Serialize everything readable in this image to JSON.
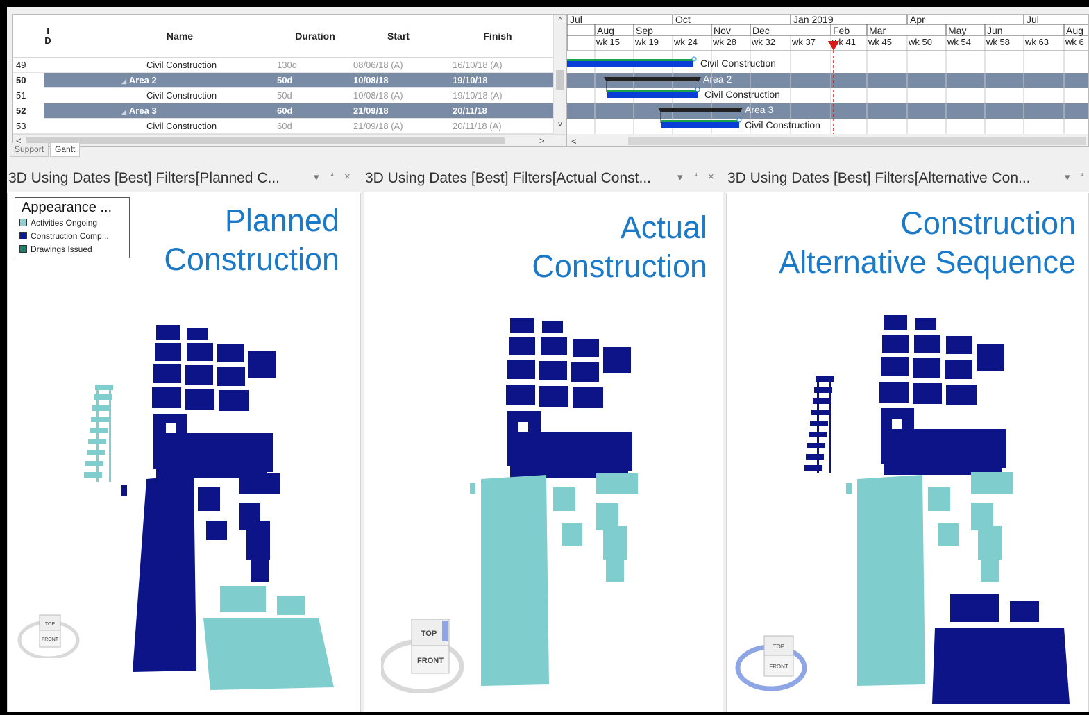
{
  "task_table": {
    "headers": {
      "id_line1": "I",
      "id_line2": "D",
      "name": "Name",
      "duration": "Duration",
      "start": "Start",
      "finish": "Finish"
    },
    "rows": [
      {
        "id": "49",
        "name": "Civil Construction",
        "duration": "130d",
        "start": "08/06/18 (A)",
        "finish": "16/10/18 (A)",
        "summary": false
      },
      {
        "id": "50",
        "name": "Area 2",
        "duration": "50d",
        "start": "10/08/18",
        "finish": "19/10/18",
        "summary": true
      },
      {
        "id": "51",
        "name": "Civil Construction",
        "duration": "50d",
        "start": "10/08/18 (A)",
        "finish": "19/10/18 (A)",
        "summary": false
      },
      {
        "id": "52",
        "name": "Area 3",
        "duration": "60d",
        "start": "21/09/18",
        "finish": "20/11/18",
        "summary": true
      },
      {
        "id": "53",
        "name": "Civil Construction",
        "duration": "60d",
        "start": "21/09/18 (A)",
        "finish": "20/11/18 (A)",
        "summary": false
      }
    ],
    "scroll_left": "<",
    "scroll_right": ">",
    "scroll_up": "^",
    "scroll_down": "v"
  },
  "gantt": {
    "top_scale": [
      "Jul",
      "Oct",
      "Jan 2019",
      "Apr",
      "Jul"
    ],
    "month_scale": [
      "Aug",
      "Sep",
      "Nov",
      "Dec",
      "Feb",
      "Mar",
      "May",
      "Jun",
      "Aug"
    ],
    "week_scale": [
      "wk 15",
      "wk 19",
      "wk 24",
      "wk 28",
      "wk 32",
      "wk 37",
      "wk 41",
      "wk 45",
      "wk 50",
      "wk 54",
      "wk 58",
      "wk 63",
      "wk 6"
    ],
    "bar_labels": [
      "Civil Construction",
      "Area 2",
      "Civil Construction",
      "Area 3",
      "Civil Construction"
    ],
    "scroll_left": "<",
    "colors": {
      "bar_fill": "#0a3ed8",
      "bar_progress": "#19a34a",
      "summary": "#222222",
      "status_line": "#d81a1a",
      "summary_row": "#7a8ba6"
    }
  },
  "tabs": [
    {
      "label": "Support",
      "active": false
    },
    {
      "label": "Gantt",
      "active": true
    }
  ],
  "panels": [
    {
      "title": "3D Using Dates [Best] Filters[Planned C...",
      "controls": {
        "dropdown": "▾",
        "pin": "⁴",
        "close": "×"
      },
      "scene_label_line1": "Planned",
      "scene_label_line2": "Construction",
      "nav_top": "TOP",
      "nav_front": "FRONT"
    },
    {
      "title": "3D Using Dates [Best] Filters[Actual Const...",
      "controls": {
        "dropdown": "▾",
        "pin": "⁴",
        "close": "×"
      },
      "scene_label_line1": "Actual",
      "scene_label_line2": "Construction",
      "nav_top": "TOP",
      "nav_front": "FRONT"
    },
    {
      "title": "3D Using Dates [Best] Filters[Alternative Con...",
      "controls": {
        "dropdown": "▾",
        "pin": "⁴",
        "close": ""
      },
      "scene_label_line1": "Construction",
      "scene_label_line2": "Alternative Sequence",
      "nav_top": "TOP",
      "nav_front": "FRONT"
    }
  ],
  "legend": {
    "title": "Appearance ...",
    "items": [
      {
        "label": "Activities Ongoing",
        "color": "#8ed0d2"
      },
      {
        "label": "Construction Comp...",
        "color": "#0b1a9a"
      },
      {
        "label": "Drawings Issued",
        "color": "#1e7e66"
      }
    ]
  },
  "colors": {
    "complete": "#0c1488",
    "ongoing": "#7fcdcd",
    "label_blue": "#1a7ac8"
  }
}
